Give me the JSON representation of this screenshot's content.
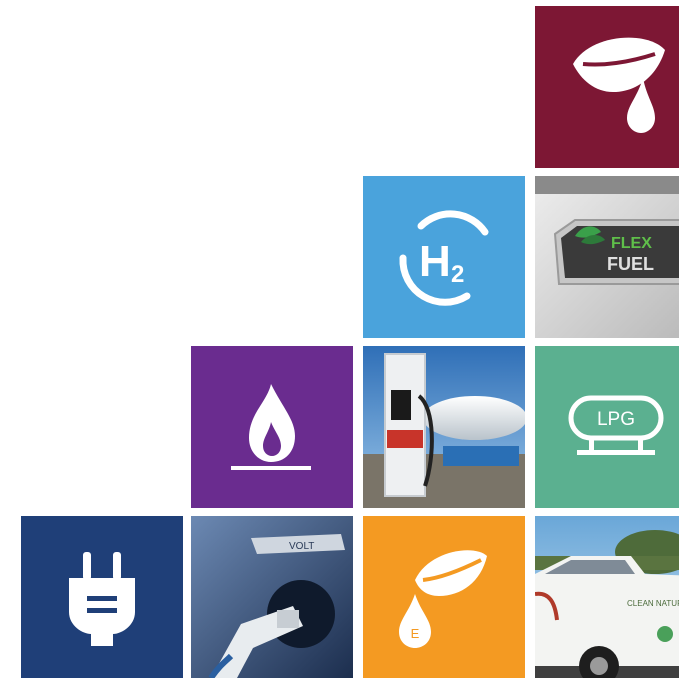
{
  "colors": {
    "biodiesel": "#7d1734",
    "hydrogen": "#4aa3dc",
    "natural_gas": "#6a2c8f",
    "propane": "#5bb090",
    "electricity": "#1f3f78",
    "ethanol": "#f49a22"
  },
  "icons": {
    "biodiesel": "leaf-drop-icon",
    "hydrogen": "h2-icon",
    "natural_gas": "flame-icon",
    "propane": "lpg-tank-icon",
    "electricity": "plug-icon",
    "ethanol": "leaf-e-drop-icon"
  },
  "labels": {
    "h2_main": "H",
    "h2_sub": "2",
    "lpg": "LPG",
    "ethanol_letter": "E",
    "flex_line1": "FLEX",
    "flex_line2": "FUEL",
    "volt_badge": "VOLT",
    "truck_decal": "CLEAN NATURAL G"
  }
}
